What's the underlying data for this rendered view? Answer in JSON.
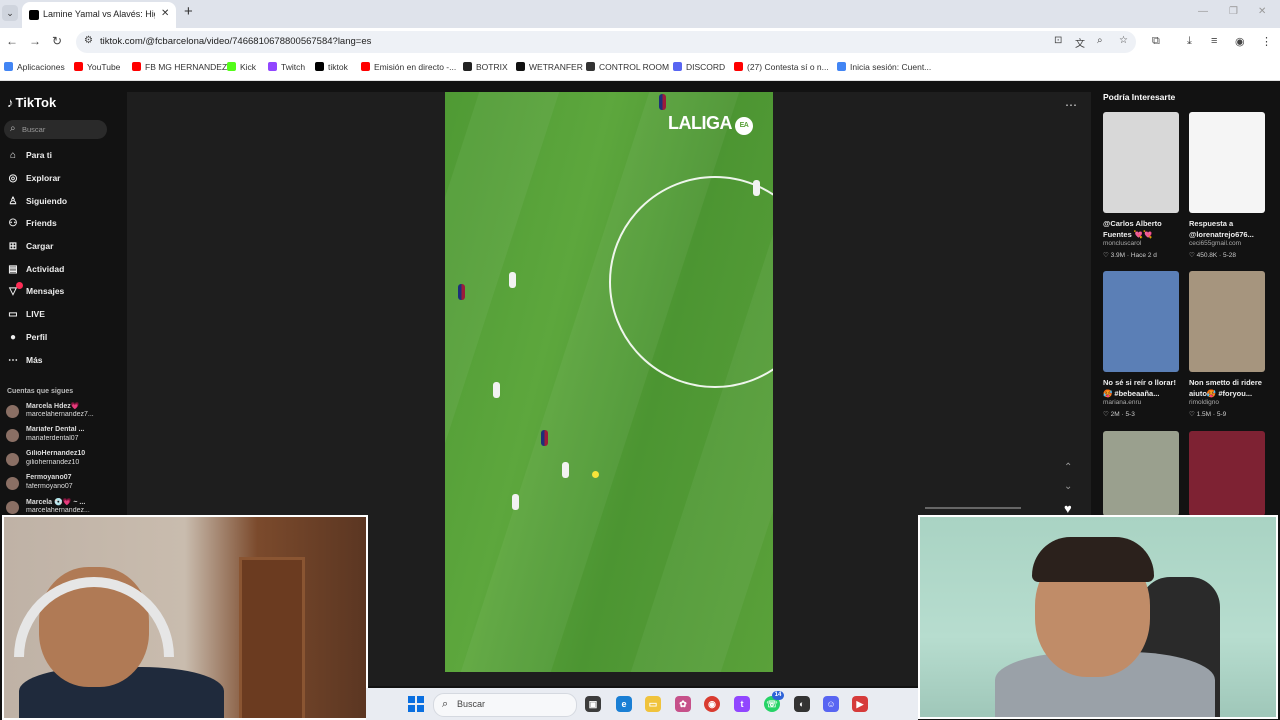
{
  "browser": {
    "tab_title": "Lamine Yamal vs Alavés: Highlig",
    "tab_close": "✕",
    "new_tab": "+",
    "url": "tiktok.com/@fcbarcelona/video/7466810678800567584?lang=es",
    "bookmarks": [
      {
        "label": "Aplicaciones",
        "color": "#4285f4"
      },
      {
        "label": "YouTube",
        "color": "#ff0000"
      },
      {
        "label": "FB MG HERNANDEZ",
        "color": "#ff0000"
      },
      {
        "label": "Kick",
        "color": "#53fc18"
      },
      {
        "label": "Twitch",
        "color": "#9146ff"
      },
      {
        "label": "tiktok",
        "color": "#000000"
      },
      {
        "label": "Emisión en directo -...",
        "color": "#ff0000"
      },
      {
        "label": "BOTRIX",
        "color": "#222222"
      },
      {
        "label": "WETRANFER",
        "color": "#111111"
      },
      {
        "label": "CONTROL ROOM",
        "color": "#333333"
      },
      {
        "label": "DISCORD",
        "color": "#5865f2"
      },
      {
        "label": "(27) Contesta sí o n...",
        "color": "#ff0000"
      },
      {
        "label": "Inicia sesión: Cuent...",
        "color": "#4285f4"
      }
    ]
  },
  "tiktok": {
    "logo": "TikTok",
    "search_placeholder": "Buscar",
    "nav": [
      {
        "label": "Para ti",
        "icon": "home-icon",
        "glyph": "⌂"
      },
      {
        "label": "Explorar",
        "icon": "compass-icon",
        "glyph": "◎"
      },
      {
        "label": "Siguiendo",
        "icon": "following-icon",
        "glyph": "♙"
      },
      {
        "label": "Friends",
        "icon": "friends-icon",
        "glyph": "⚇"
      },
      {
        "label": "Cargar",
        "icon": "upload-icon",
        "glyph": "⊞"
      },
      {
        "label": "Actividad",
        "icon": "activity-icon",
        "glyph": "▤"
      },
      {
        "label": "Mensajes",
        "icon": "messages-icon",
        "glyph": "▽"
      },
      {
        "label": "LIVE",
        "icon": "live-icon",
        "glyph": "▭"
      },
      {
        "label": "Perfil",
        "icon": "profile-icon",
        "glyph": "●"
      },
      {
        "label": "Más",
        "icon": "more-icon",
        "glyph": "⋯"
      }
    ],
    "following_title": "Cuentas que sigues",
    "following": [
      {
        "name": "Marcela Hdez💗",
        "handle": "marcelahernandez7..."
      },
      {
        "name": "Mariafer Dental ...",
        "handle": "mariaferdental07"
      },
      {
        "name": "GilioHernandez10",
        "handle": "giliohernandez10"
      },
      {
        "name": "Fermoyano07",
        "handle": "fafermoyano07"
      },
      {
        "name": "Marcela 💿💗 ~ ...",
        "handle": "marcelahernandez..."
      }
    ],
    "video_overlay": "LALIGA",
    "video_overlay_badge": "EA",
    "recommendations_title": "Podría Interesarte",
    "recommendations": [
      {
        "title": "@Carlos Alberto Fuentes 💘💘",
        "user": "moncluscarol",
        "stats": "♡ 3.9M · Hace 2 d",
        "color": "#d8d8d8"
      },
      {
        "title": "Respuesta a @lorenatrejo676...",
        "user": "ceci655gmail.com",
        "stats": "♡ 450.8K · 5-28",
        "color": "#f5f5f5"
      },
      {
        "title": "No sé si reír o llorar! 🥵 #bebeaaña...",
        "user": "mariana.enru",
        "stats": "♡ 2M · 5-3",
        "color": "#5b7fb6"
      },
      {
        "title": "Non smetto di ridere aiuto🥵 #foryou...",
        "user": "rimoldigno",
        "stats": "♡ 1.5M · 5-9",
        "color": "#a6957e"
      },
      {
        "title": "",
        "user": "",
        "stats": "",
        "color": "#9aa08e"
      },
      {
        "title": "",
        "user": "",
        "stats": "",
        "color": "#7e2233"
      }
    ]
  },
  "taskbar": {
    "search_label": "Buscar",
    "whatsapp_badge": "14"
  }
}
